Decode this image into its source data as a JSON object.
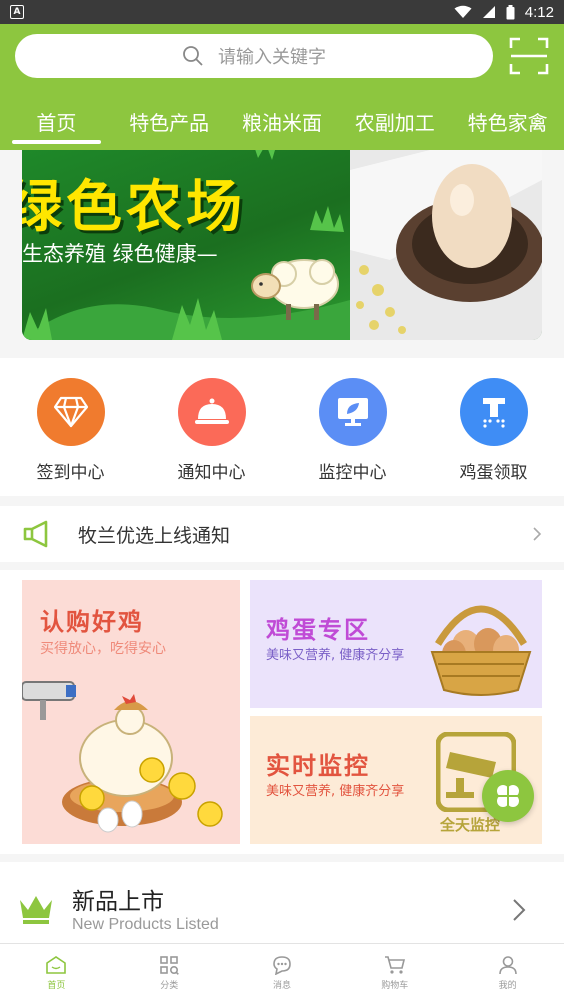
{
  "status_bar": {
    "time": "4:12",
    "app_icon_letter": "A"
  },
  "search": {
    "placeholder": "请输入关键字"
  },
  "nav_tabs": [
    {
      "label": "首页",
      "active": true
    },
    {
      "label": "特色产品"
    },
    {
      "label": "粮油米面"
    },
    {
      "label": "农副加工"
    },
    {
      "label": "特色家禽"
    }
  ],
  "banner": {
    "title": "绿色农场",
    "subtitle": "生态养殖  绿色健康—"
  },
  "quick_actions": [
    {
      "label": "签到中心",
      "icon": "diamond-icon",
      "color": "#f07b2e"
    },
    {
      "label": "通知中心",
      "icon": "bell-icon",
      "color": "#fb6a58"
    },
    {
      "label": "监控中心",
      "icon": "monitor-icon",
      "color": "#5b8ef5"
    },
    {
      "label": "鸡蛋领取",
      "icon": "egg-pickup-icon",
      "color": "#3f8df5"
    }
  ],
  "notice": {
    "text": "牧兰优选上线通知"
  },
  "promos": {
    "chicken": {
      "title": "认购好鸡",
      "subtitle": "买得放心，吃得安心"
    },
    "eggs": {
      "title": "鸡蛋专区",
      "subtitle": "美味又营养, 健康齐分享"
    },
    "monitor": {
      "title": "实时监控",
      "subtitle": "美味又营养, 健康齐分享",
      "badge": "全天监控"
    }
  },
  "section": {
    "title": "新品上市",
    "subtitle": "New Products Listed"
  },
  "bottom_nav": [
    {
      "label": "首页",
      "icon": "home-icon",
      "active": true
    },
    {
      "label": "分类",
      "icon": "grid-icon"
    },
    {
      "label": "消息",
      "icon": "message-icon"
    },
    {
      "label": "购物车",
      "icon": "cart-icon"
    },
    {
      "label": "我的",
      "icon": "user-icon"
    }
  ],
  "colors": {
    "brand_green": "#8dc63f"
  }
}
